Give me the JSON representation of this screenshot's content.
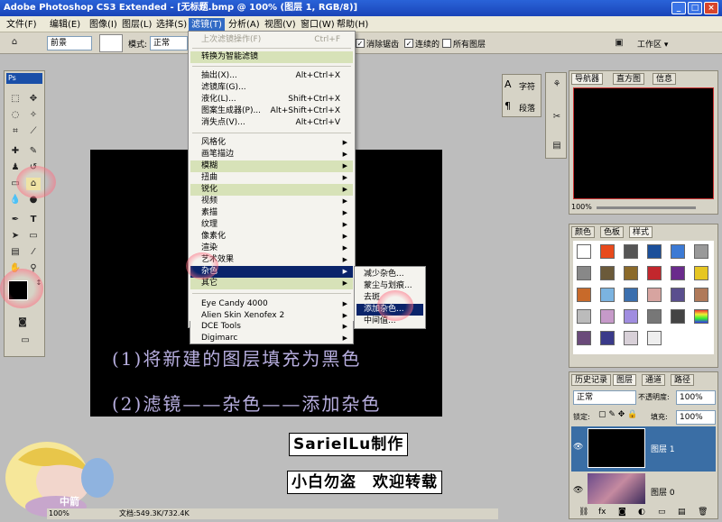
{
  "window": {
    "title": "Adobe Photoshop CS3 Extended - [无标题.bmp @ 100% (图层 1, RGB/8)]",
    "buttons": [
      "_",
      "□",
      "×"
    ]
  },
  "menubar": {
    "items": [
      "文件(F)",
      "编辑(E)",
      "图像(I)",
      "图层(L)",
      "选择(S)",
      "滤镜(T)",
      "分析(A)",
      "视图(V)",
      "窗口(W)",
      "帮助(H)"
    ],
    "active_index": 5
  },
  "options": {
    "fill_label": "前景",
    "mode_label": "模式:",
    "mode_value": "正常",
    "antialias_label": "消除锯齿",
    "contiguous_label": "连续的",
    "all_layers_label": "所有图层",
    "workspace_label": "工作区 ▾"
  },
  "filter_menu": {
    "last_filter": {
      "label": "上次滤镜操作(F)",
      "shortcut": "Ctrl+F"
    },
    "smart": "转换为智能滤镜",
    "group1": [
      {
        "label": "抽出(X)...",
        "shortcut": "Alt+Ctrl+X"
      },
      {
        "label": "滤镜库(G)...",
        "shortcut": ""
      },
      {
        "label": "液化(L)...",
        "shortcut": "Shift+Ctrl+X"
      },
      {
        "label": "图案生成器(P)...",
        "shortcut": "Alt+Shift+Ctrl+X"
      },
      {
        "label": "消失点(V)...",
        "shortcut": "Alt+Ctrl+V"
      }
    ],
    "group2": [
      "风格化",
      "画笔描边",
      "模糊",
      "扭曲",
      "锐化",
      "视频",
      "素描",
      "纹理",
      "像素化",
      "渲染",
      "艺术效果",
      "杂色",
      "其它"
    ],
    "group3": [
      "Eye Candy 4000",
      "Alien Skin Xenofex 2",
      "DCE Tools",
      "Digimarc"
    ]
  },
  "noise_submenu": [
    "减少杂色...",
    "蒙尘与划痕...",
    "去斑",
    "添加杂色...",
    "中间值..."
  ],
  "canvas_text": {
    "step1": "(1)将新建的图层填充为黑色",
    "step2": "(2)滤镜——杂色——添加杂色"
  },
  "banners": {
    "author": "SarielLu制作",
    "notice": "小白勿盗　欢迎转载"
  },
  "logo_text": "中箭",
  "character_panel": {
    "char_label": "字符",
    "para_label": "段落"
  },
  "navigator": {
    "tabs": [
      "导航器",
      "直方图",
      "信息"
    ],
    "zoom": "100%"
  },
  "styles_panel": {
    "tabs": [
      "颜色",
      "色板",
      "样式"
    ]
  },
  "layers_panel": {
    "tabs": [
      "历史记录",
      "图层",
      "通道",
      "路径"
    ],
    "blend_mode": "正常",
    "opacity_label": "不透明度:",
    "opacity_value": "100%",
    "lock_label": "锁定:",
    "fill_label": "填充:",
    "fill_value": "100%",
    "layers": [
      {
        "name": "图层 1"
      },
      {
        "name": "图层 0"
      }
    ]
  },
  "status": {
    "zoom": "100%",
    "doc_info": "文档:549.3K/732.4K"
  },
  "colors": {
    "title_bar": "#2459d0",
    "menu_highlight": "#316ac5",
    "selected_menu": "#0a246a",
    "layer_selected": "#3a6ea5",
    "caption_text": "#b7aedf"
  }
}
